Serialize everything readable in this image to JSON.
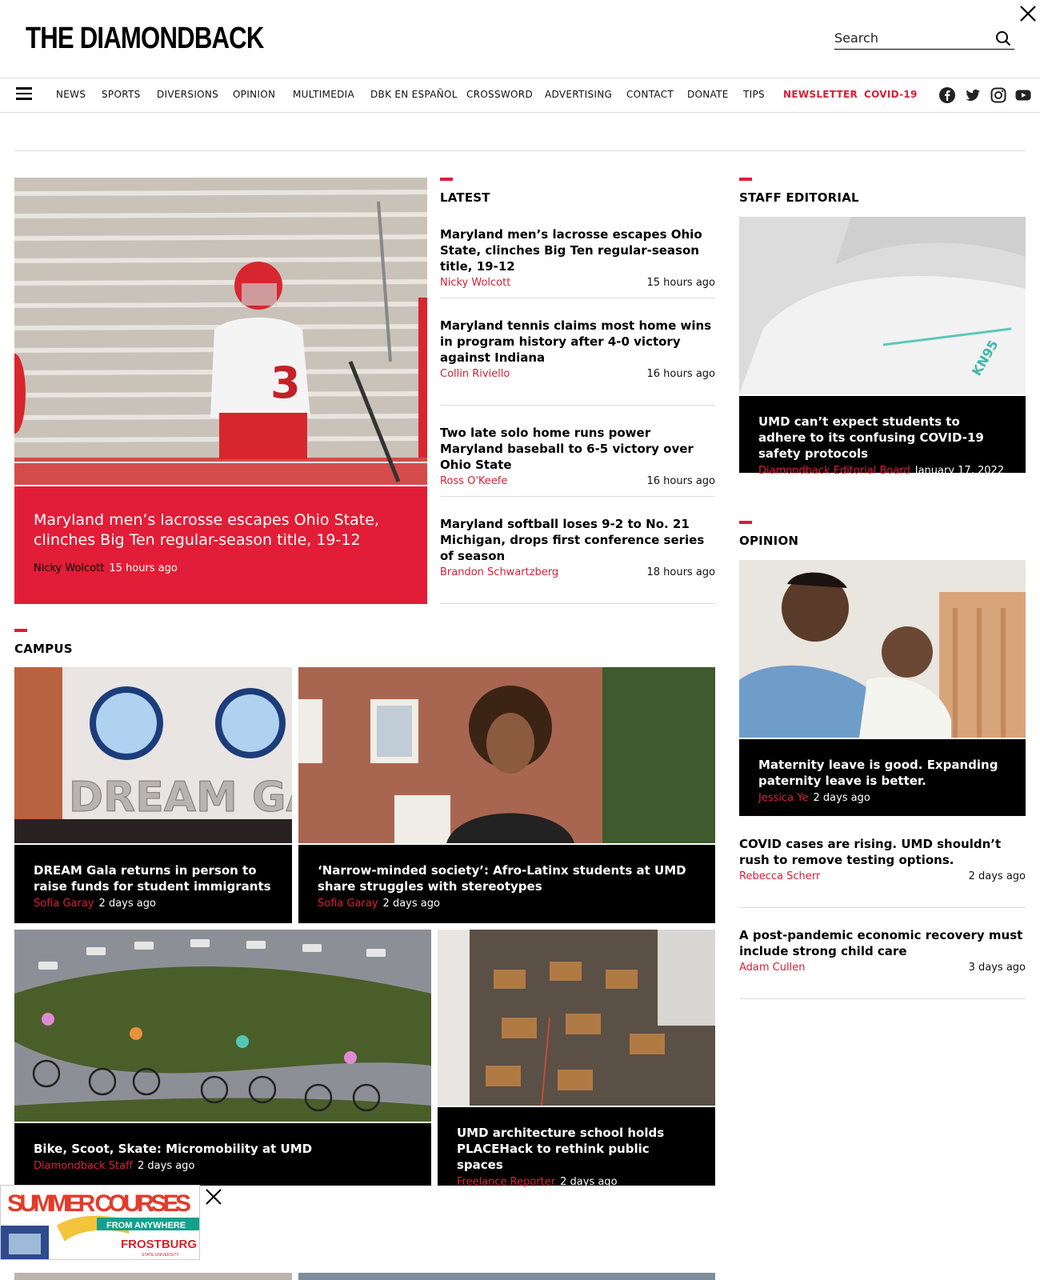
{
  "header": {
    "logo": "THE DIAMONDBACK",
    "search_placeholder": "Search"
  },
  "nav": {
    "items": [
      "NEWS",
      "SPORTS",
      "DIVERSIONS",
      "OPINION",
      "MULTIMEDIA",
      "DBK EN ESPAÑOL",
      "CROSSWORD",
      "ADVERTISING",
      "CONTACT",
      "DONATE",
      "TIPS",
      "NEWSLETTER",
      "COVID-19"
    ],
    "social": [
      "facebook-icon",
      "twitter-icon",
      "instagram-icon",
      "youtube-icon"
    ]
  },
  "colors": {
    "accent": "#d91e36",
    "hero_bg": "#e21d37",
    "card_bg": "#000000"
  },
  "hero": {
    "headline": "Maryland men’s lacrosse escapes Ohio State, clinches Big Ten regular-season title, 19-12",
    "author": "Nicky Wolcott",
    "time": "15 hours ago"
  },
  "latest": {
    "title": "LATEST",
    "items": [
      {
        "headline": "Maryland men’s lacrosse escapes Ohio State, clinches Big Ten regular-season title, 19-12",
        "author": "Nicky Wolcott",
        "time": "15 hours ago"
      },
      {
        "headline": "Maryland tennis claims most home wins in program history after 4-0 victory against Indiana",
        "author": "Collin Riviello",
        "time": "16 hours ago"
      },
      {
        "headline": "Two late solo home runs power Maryland baseball to 6-5 victory over Ohio State",
        "author": "Ross O'Keefe",
        "time": "16 hours ago"
      },
      {
        "headline": "Maryland softball loses 9-2 to No. 21 Michigan, drops first conference series of season",
        "author": "Brandon Schwartzberg",
        "time": "18 hours ago"
      }
    ]
  },
  "staff_editorial": {
    "title": "STAFF EDITORIAL",
    "headline": "UMD can’t expect students to adhere to its confusing COVID-19 safety protocols",
    "author": "Diamondback Editorial Board",
    "time": "January 17, 2022",
    "image_text": "KN95"
  },
  "opinion": {
    "title": "OPINION",
    "featured": {
      "headline": "Maternity leave is good. Expanding paternity leave is better.",
      "author": "Jessica Ye",
      "time": "2 days ago"
    },
    "items": [
      {
        "headline": "COVID cases are rising. UMD shouldn’t rush to remove testing options.",
        "author": "Rebecca Scherr",
        "time": "2 days ago"
      },
      {
        "headline": "A post-pandemic economic recovery must include strong child care",
        "author": "Adam Cullen",
        "time": "3 days ago"
      }
    ]
  },
  "campus": {
    "title": "CAMPUS",
    "cards": [
      {
        "headline": "DREAM Gala returns in person to raise funds for student immigrants",
        "author": "Sofia Garay",
        "time": "2 days ago",
        "image_text": "DREAM GAL"
      },
      {
        "headline": "‘Narrow-minded society’: Afro-Latinx students at UMD share struggles with stereotypes",
        "author": "Sofia Garay",
        "time": "2 days ago"
      },
      {
        "headline": "Bike, Scoot, Skate: Micromobility at UMD",
        "author": "Diamondback Staff",
        "time": "2 days ago"
      },
      {
        "headline": "UMD architecture school holds PLACEHack to rethink public spaces",
        "author": "Freelance Reporter",
        "time": "2 days ago"
      }
    ]
  },
  "ad": {
    "line1": "SUMMER COURSES",
    "line2": "FROM ANYWHERE",
    "brand": "FROSTBURG",
    "brand_sub": "STATE UNIVERSITY"
  }
}
